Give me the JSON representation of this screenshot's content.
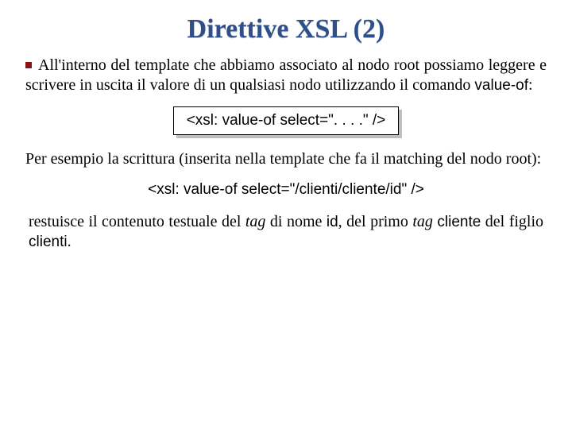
{
  "title": "Direttive XSL (2)",
  "p1_before": "All'interno del template che abbiamo associato al nodo root possiamo leggere e scrivere in uscita il valore di un qualsiasi nodo utilizzando il comando ",
  "p1_code": "value-of",
  "p1_after": ":",
  "codebox": "<xsl: value-of select=\". . . .\" />",
  "p2": "Per esempio la scrittura (inserita nella template che fa il matching del nodo root):",
  "codeline": "<xsl: value-of select=\"/clienti/cliente/id\" />",
  "p3_a": "restuisce il contenuto testuale del ",
  "p3_i1": "tag",
  "p3_b": " di nome ",
  "p3_c1": "id",
  "p3_c": ", del primo ",
  "p3_i2": "tag",
  "p3_d": " ",
  "p3_c2": "cliente",
  "p3_e": " del figlio ",
  "p3_c3": "clienti",
  "p3_f": "."
}
